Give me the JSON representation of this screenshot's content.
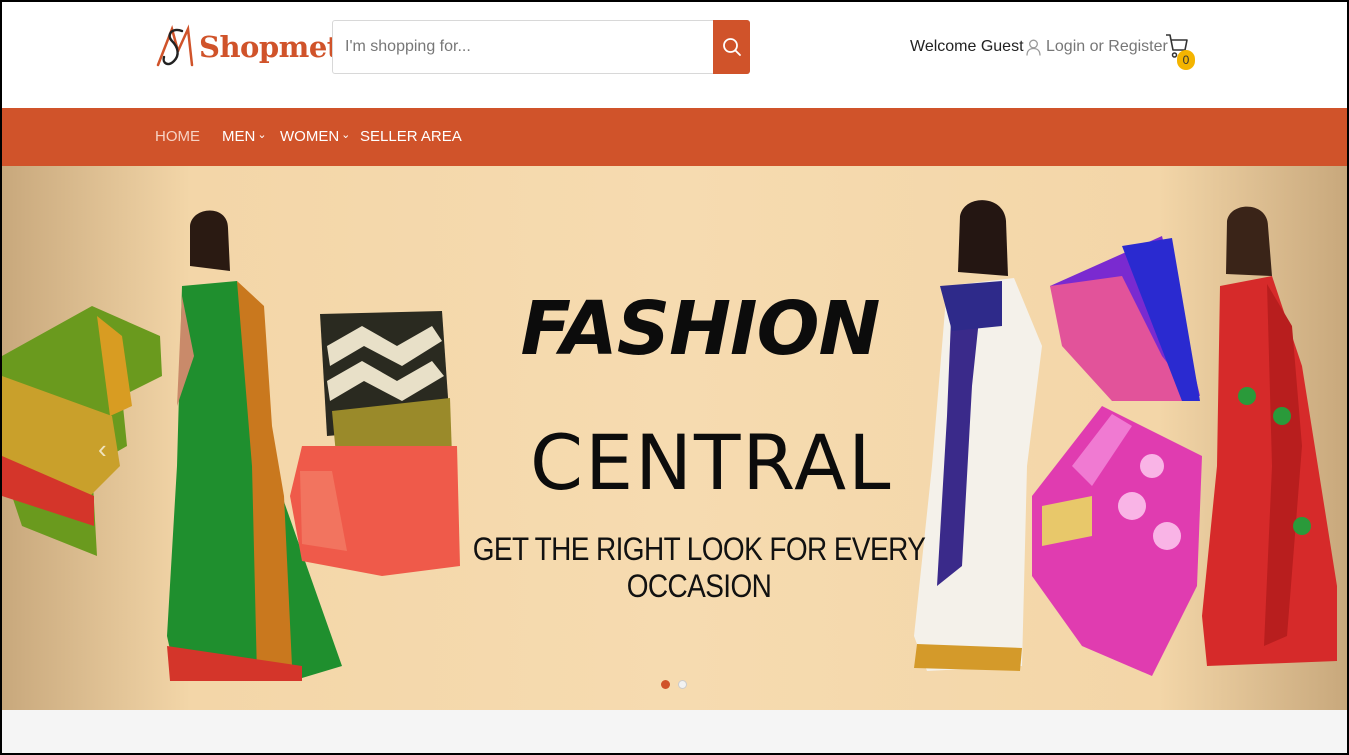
{
  "header": {
    "logo_text": "Shopmet",
    "search_placeholder": "I'm shopping for...",
    "welcome": "Welcome Guest",
    "login": "Login or Register",
    "cart_count": "0"
  },
  "nav": {
    "items": [
      {
        "label": "HOME"
      },
      {
        "label": "MEN"
      },
      {
        "label": "WOMEN"
      },
      {
        "label": "SELLER AREA"
      }
    ]
  },
  "banner": {
    "headline_1": "FASHION",
    "headline_2": "CENTRAL",
    "tagline": "GET THE RIGHT LOOK FOR EVERY OCCASION",
    "active_slide": 1,
    "slide_count": 2
  },
  "colors": {
    "brand": "#d0532a",
    "badge": "#f4b400",
    "banner_bg": "#f6dbb0"
  },
  "icons": [
    "logo-mark-icon",
    "search-icon",
    "user-icon",
    "cart-icon",
    "chevron-down-icon",
    "chevron-left-icon"
  ]
}
